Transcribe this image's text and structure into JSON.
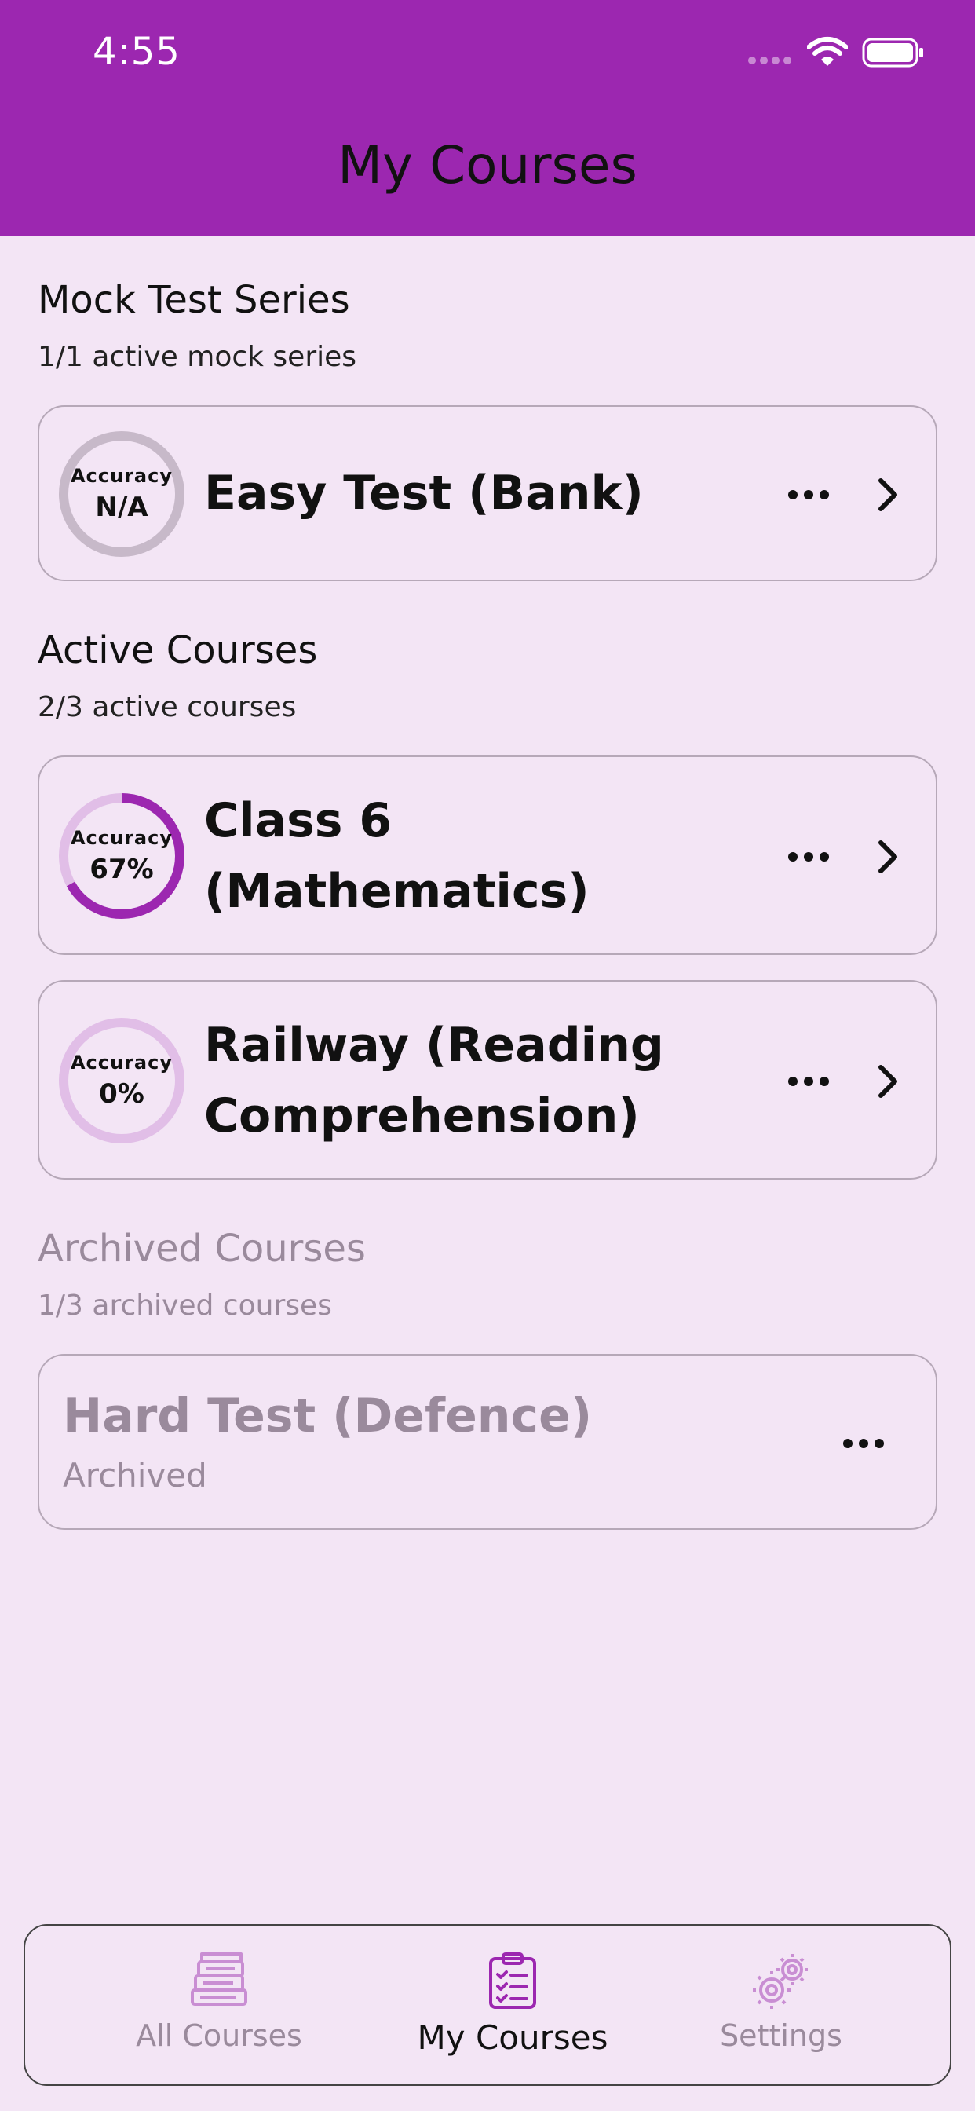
{
  "status": {
    "time": "4:55"
  },
  "header": {
    "title": "My Courses"
  },
  "mock": {
    "title": "Mock Test Series",
    "subtitle": "1/1 active mock series",
    "items": [
      {
        "acc_label": "Accuracy",
        "acc_value": "N/A",
        "accuracy": null,
        "title": "Easy Test (Bank)"
      }
    ]
  },
  "active": {
    "title": "Active Courses",
    "subtitle": "2/3 active courses",
    "items": [
      {
        "acc_label": "Accuracy",
        "acc_value": "67%",
        "accuracy": 0.67,
        "title_line1": "Class 6",
        "title_line2": "(Mathematics)"
      },
      {
        "acc_label": "Accuracy",
        "acc_value": "0%",
        "accuracy": 0,
        "title_line1": "Railway (Reading",
        "title_line2": "Comprehension)"
      }
    ]
  },
  "archived": {
    "title": "Archived Courses",
    "subtitle": "1/3 archived courses",
    "items": [
      {
        "title": "Hard Test (Defence)",
        "status": "Archived"
      }
    ]
  },
  "nav": {
    "items": [
      {
        "label": "All Courses",
        "icon": "books-icon",
        "active": false
      },
      {
        "label": "My Courses",
        "icon": "clipboard-list-icon",
        "active": true
      },
      {
        "label": "Settings",
        "icon": "gears-icon",
        "active": false
      }
    ]
  },
  "colors": {
    "primary": "#9c27b0",
    "background": "#f3e5f5",
    "ring_track": "#e1bee7",
    "ring_na": "#c7b9c9",
    "muted": "#9a8a9c"
  }
}
